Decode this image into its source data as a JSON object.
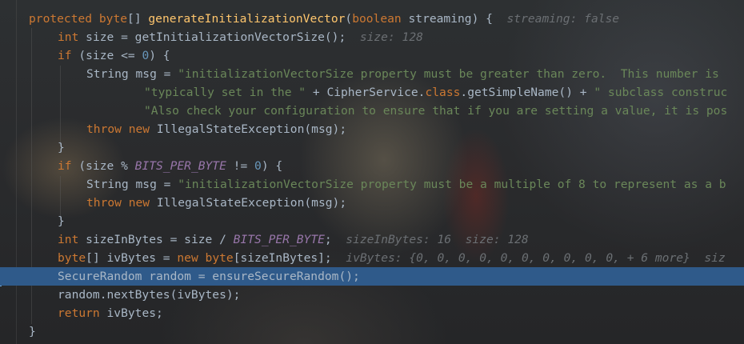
{
  "editor": {
    "lines": [
      [
        [
          "protected ",
          "kw"
        ],
        [
          "byte",
          "kw"
        ],
        [
          "[] ",
          ""
        ],
        [
          "generateInitializationVector",
          "fn"
        ],
        [
          "(",
          ""
        ],
        [
          "boolean ",
          "kw"
        ],
        [
          "streaming) {",
          ""
        ],
        [
          "  streaming: false",
          "hint"
        ]
      ],
      [
        [
          "int ",
          "kw"
        ],
        [
          "size = getInitializationVectorSize();",
          ""
        ],
        [
          "  size: 128",
          "hint"
        ]
      ],
      [
        [
          "if ",
          "kw"
        ],
        [
          "(size <= ",
          ""
        ],
        [
          "0",
          "num"
        ],
        [
          ") {",
          ""
        ]
      ],
      [
        [
          "String msg = ",
          ""
        ],
        [
          "\"initializationVectorSize property must be greater than zero.  This number is ",
          "str"
        ]
      ],
      [
        [
          "\"typically set in the \" ",
          "str"
        ],
        [
          "+ CipherService.",
          ""
        ],
        [
          "class",
          "kw"
        ],
        [
          ".getSimpleName() + ",
          ""
        ],
        [
          "\" subclass construc",
          "str"
        ]
      ],
      [
        [
          "\"Also check your configuration to ensure that if you are setting a value, it is pos",
          "str"
        ]
      ],
      [
        [
          "throw new ",
          "kw"
        ],
        [
          "IllegalStateException(msg);",
          ""
        ]
      ],
      [
        [
          "}",
          ""
        ]
      ],
      [
        [
          "if ",
          "kw"
        ],
        [
          "(size % ",
          ""
        ],
        [
          "BITS_PER_BYTE",
          "const"
        ],
        [
          " != ",
          ""
        ],
        [
          "0",
          "num"
        ],
        [
          ") {",
          ""
        ]
      ],
      [
        [
          "String msg = ",
          ""
        ],
        [
          "\"initializationVectorSize property must be a multiple of 8 to represent as a b",
          "str"
        ]
      ],
      [
        [
          "throw new ",
          "kw"
        ],
        [
          "IllegalStateException(msg);",
          ""
        ]
      ],
      [
        [
          "}",
          ""
        ]
      ],
      [
        [
          "int ",
          "kw"
        ],
        [
          "sizeInBytes = size / ",
          ""
        ],
        [
          "BITS_PER_BYTE",
          "const"
        ],
        [
          ";",
          ""
        ],
        [
          "  sizeInBytes: 16  size: 128",
          "hint"
        ]
      ],
      [
        [
          "byte",
          "kw"
        ],
        [
          "[] ivBytes = ",
          ""
        ],
        [
          "new ",
          "kw"
        ],
        [
          "byte",
          "kw"
        ],
        [
          "[sizeInBytes];",
          ""
        ],
        [
          "  ivBytes: {0, 0, 0, 0, 0, 0, 0, 0, 0, 0, + 6 more}  siz",
          "hint"
        ]
      ],
      [
        [
          "SecureRandom random = ensureSecureRandom();",
          ""
        ]
      ],
      [
        [
          "random.nextBytes(ivBytes);",
          ""
        ]
      ],
      [
        [
          "return ",
          "kw"
        ],
        [
          "ivBytes;",
          ""
        ]
      ],
      [
        [
          "}",
          ""
        ]
      ]
    ],
    "current_line": 14
  }
}
